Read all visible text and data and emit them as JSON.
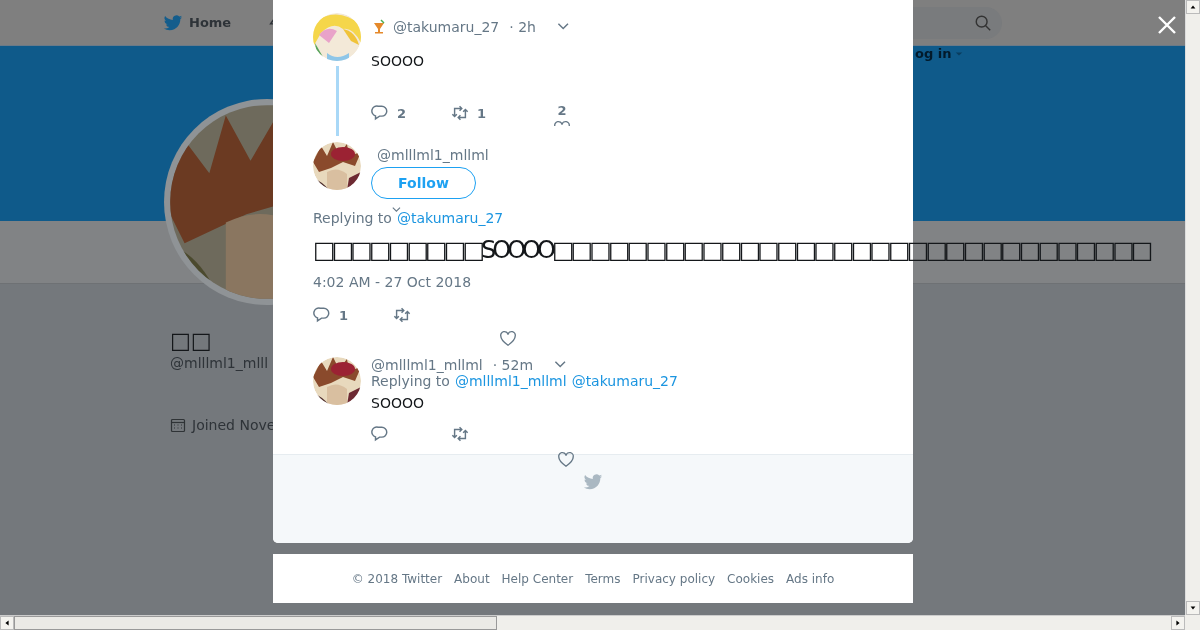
{
  "nav": {
    "home": "Home",
    "login": "og in"
  },
  "profile": {
    "name": "□□",
    "handle": "@mlllml1_mlll",
    "joined": "Joined Nove"
  },
  "parent_tweet": {
    "handle": "@takumaru_27",
    "time": "· 2h",
    "text": "SOOOO",
    "replies": "2",
    "retweets": "1",
    "likes": "2"
  },
  "main_tweet": {
    "handle": "@mlllml1_mllml",
    "follow": "Follow",
    "replying_label": "Replying to",
    "replying_to": [
      "@takumaru_27"
    ],
    "text": "□□□□□□□□□SOOOO□□□□□□□□□□□□□□□□□□□□□□□□□□□□□□□□",
    "timestamp": "4:02 AM - 27 Oct 2018",
    "replies": "1"
  },
  "reply_tweet": {
    "handle": "@mlllml1_mllml",
    "time": "· 52m",
    "replying_label": "Replying to",
    "replying_to": [
      "@mlllml1_mllml",
      "@takumaru_27"
    ],
    "text": "SOOOO"
  },
  "footer": [
    "© 2018 Twitter",
    "About",
    "Help Center",
    "Terms",
    "Privacy policy",
    "Cookies",
    "Ads info"
  ]
}
